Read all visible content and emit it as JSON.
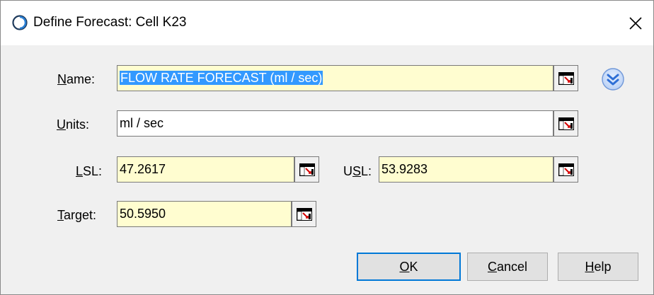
{
  "window": {
    "title": "Define Forecast: Cell K23",
    "close_glyph": "✕"
  },
  "form": {
    "name": {
      "label": "Name:",
      "accel": "N",
      "rest": "ame:",
      "value": "FLOW RATE FORECAST (ml / sec)"
    },
    "units": {
      "label": "Units:",
      "accel": "U",
      "rest": "nits:",
      "value": "ml / sec"
    },
    "lsl": {
      "label": "LSL:",
      "accel": "L",
      "rest": "SL:",
      "value": "47.2617"
    },
    "usl": {
      "label": "USL:",
      "pre": "U",
      "accel": "S",
      "rest": "L:",
      "value": "53.9283"
    },
    "target": {
      "label": "Target:",
      "accel": "T",
      "rest": "arget:",
      "value": "50.5950"
    }
  },
  "buttons": {
    "ok": {
      "label": "OK",
      "accel": "O",
      "rest": "K"
    },
    "cancel": {
      "label": "Cancel",
      "accel": "C",
      "rest": "ancel"
    },
    "help": {
      "label": "Help",
      "accel": "H",
      "rest": "elp"
    }
  },
  "icons": {
    "cell_reference": "cell-reference-icon",
    "expand": "expand-chevron-icon",
    "app": "crystal-ball-app-icon"
  },
  "colors": {
    "input_highlight": "#fffdd0",
    "selection": "#3399ff",
    "default_button_border": "#0078d7",
    "expand_icon": "#2f6fd6"
  }
}
